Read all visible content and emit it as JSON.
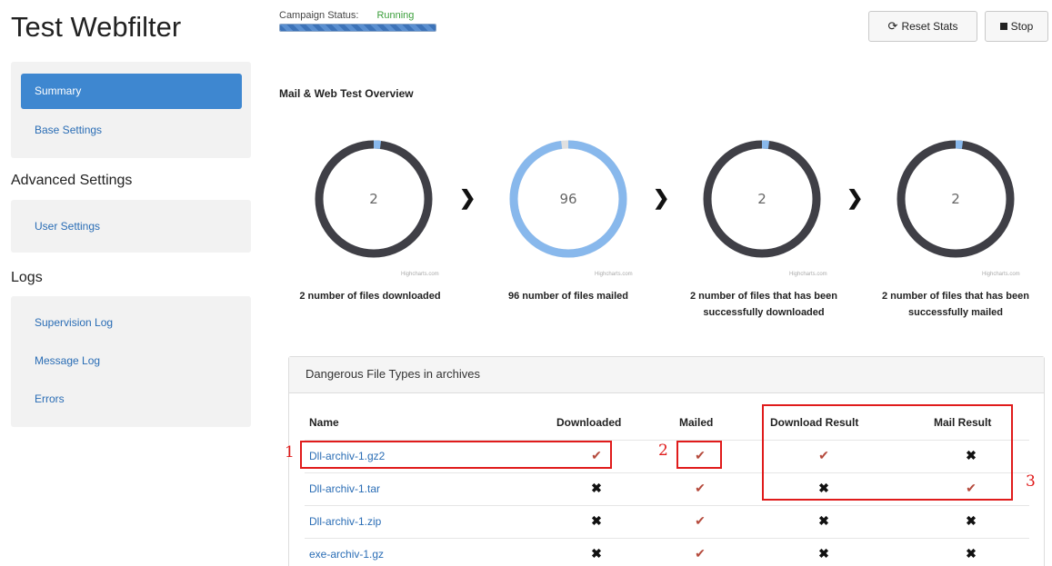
{
  "app": {
    "title": "Test Webfilter"
  },
  "campaign": {
    "status_label": "Campaign Status:",
    "status_value": "Running",
    "progress_percent": 100
  },
  "toolbar": {
    "reset_icon": "refresh-icon",
    "reset_label": "Reset Stats",
    "stop_icon": "stop-square-icon",
    "stop_label": "Stop"
  },
  "sidebar": {
    "group1": [
      {
        "label": "Summary",
        "active": true
      },
      {
        "label": "Base Settings"
      }
    ],
    "advanced_heading": "Advanced Settings",
    "group2": [
      {
        "label": "User Settings"
      }
    ],
    "logs_heading": "Logs",
    "group3": [
      {
        "label": "Supervision Log"
      },
      {
        "label": "Message Log"
      },
      {
        "label": "Errors"
      }
    ]
  },
  "overview": {
    "title": "Mail & Web Test Overview",
    "credit": "Highcharts.com",
    "donuts": [
      {
        "value": "2",
        "caption_line1": "2 number of files downloaded",
        "caption_line2": "",
        "fraction": 0.02,
        "filled": "#88b8ec",
        "track": "#3f3f46"
      },
      {
        "value": "96",
        "caption_line1": "96 number of files mailed",
        "caption_line2": "",
        "fraction": 0.98,
        "filled": "#88b8ec",
        "track": "#e0e0e0"
      },
      {
        "value": "2",
        "caption_line1": "2 number of files that has been",
        "caption_line2": "successfully downloaded",
        "fraction": 0.02,
        "filled": "#88b8ec",
        "track": "#3f3f46"
      },
      {
        "value": "2",
        "caption_line1": "2 number of files that has been",
        "caption_line2": "successfully mailed",
        "fraction": 0.02,
        "filled": "#88b8ec",
        "track": "#3f3f46"
      }
    ],
    "arrow_glyph": "❯"
  },
  "table": {
    "panel_title": "Dangerous File Types in archives",
    "headers": {
      "name": "Name",
      "downloaded": "Downloaded",
      "mailed": "Mailed",
      "download_result": "Download Result",
      "mail_result": "Mail Result"
    },
    "check_glyph": "✔",
    "cross_glyph": "✖",
    "rows": [
      {
        "name": "Dll-archiv-1.gz2",
        "downloaded": "check",
        "mailed": "check",
        "download_result": "check",
        "mail_result": "cross"
      },
      {
        "name": "Dll-archiv-1.tar",
        "downloaded": "cross",
        "mailed": "check",
        "download_result": "cross",
        "mail_result": "check"
      },
      {
        "name": "Dll-archiv-1.zip",
        "downloaded": "cross",
        "mailed": "check",
        "download_result": "cross",
        "mail_result": "cross"
      },
      {
        "name": "exe-archiv-1.gz",
        "downloaded": "cross",
        "mailed": "check",
        "download_result": "cross",
        "mail_result": "cross"
      }
    ]
  },
  "annotations": {
    "n1": "1",
    "n2": "2",
    "n3": "3",
    "color": "#e01b1b"
  }
}
